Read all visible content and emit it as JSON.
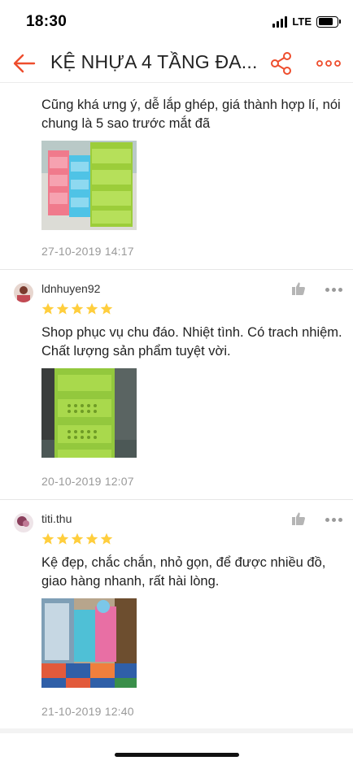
{
  "status_bar": {
    "time": "18:30",
    "network": "LTE",
    "battery_level": 0.8
  },
  "header": {
    "title": "KỆ NHỰA 4 TẦNG ĐA..."
  },
  "reviews": [
    {
      "text": "Cũng khá ưng ý, dễ lắp ghép, giá thành hợp lí, nói chung là 5 sao trước mắt đã",
      "date": "27-10-2019 14:17"
    },
    {
      "username": "ldnhuyen92",
      "rating": 5,
      "text": "Shop phục vụ chu đáo. Nhiệt tình. Có trach nhiệm. Chất lượng sản phẩm tuyệt vời.",
      "date": "20-10-2019 12:07"
    },
    {
      "username": "titi.thu",
      "rating": 5,
      "text": "Kệ đẹp, chắc chắn, nhỏ gọn, để được nhiều đồ, giao hàng nhanh, rất hài lòng.",
      "date": "21-10-2019 12:40"
    }
  ],
  "colors": {
    "accent": "#ee4d2d",
    "star": "#ffce3d",
    "muted": "#999999"
  },
  "icons": {
    "back": "arrow-left-icon",
    "share": "share-icon",
    "more": "more-horizontal-icon",
    "like": "thumbs-up-icon",
    "star": "star-icon"
  }
}
